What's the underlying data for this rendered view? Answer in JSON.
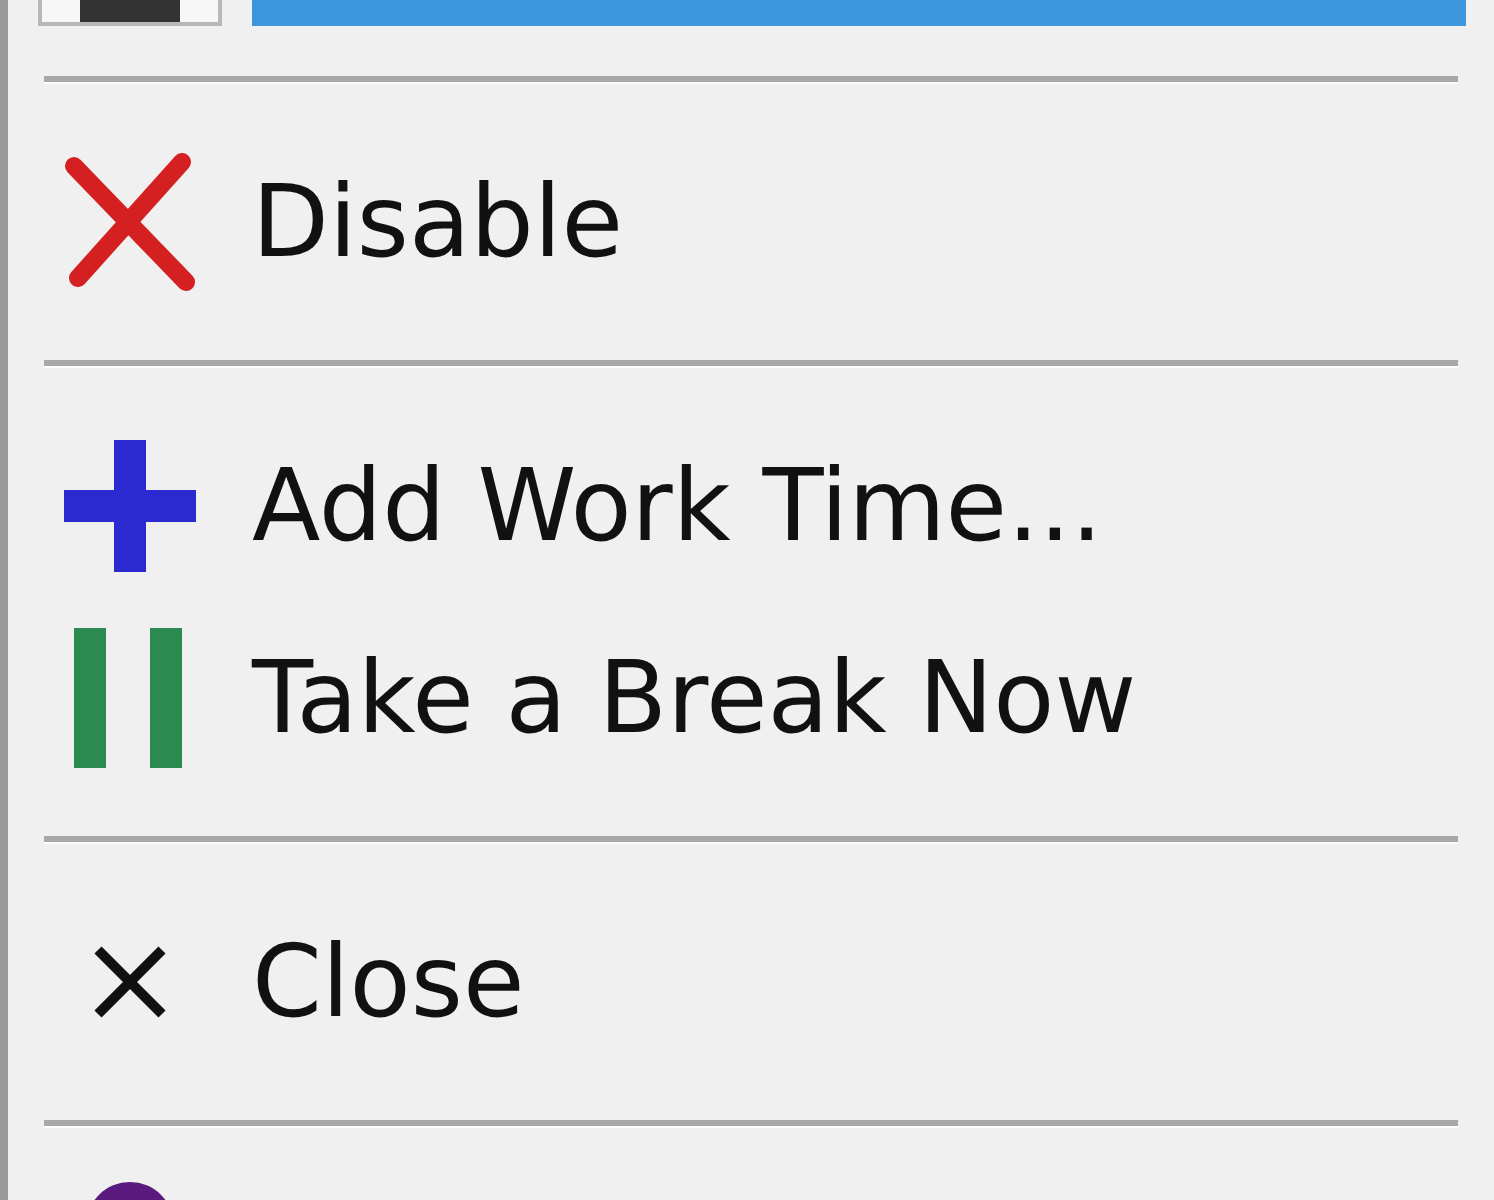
{
  "menu": {
    "items": [
      {
        "kind": "item",
        "selected": true
      },
      {
        "kind": "separator"
      },
      {
        "kind": "item",
        "label": "Disable",
        "selected": false
      },
      {
        "kind": "separator"
      },
      {
        "kind": "item",
        "label": "Add Work Time...",
        "selected": false
      },
      {
        "kind": "item",
        "label": "Take a Break Now",
        "selected": false
      },
      {
        "kind": "separator"
      },
      {
        "kind": "item",
        "label": "Close",
        "selected": false
      },
      {
        "kind": "separator"
      },
      {
        "kind": "item",
        "selected": false
      }
    ]
  }
}
